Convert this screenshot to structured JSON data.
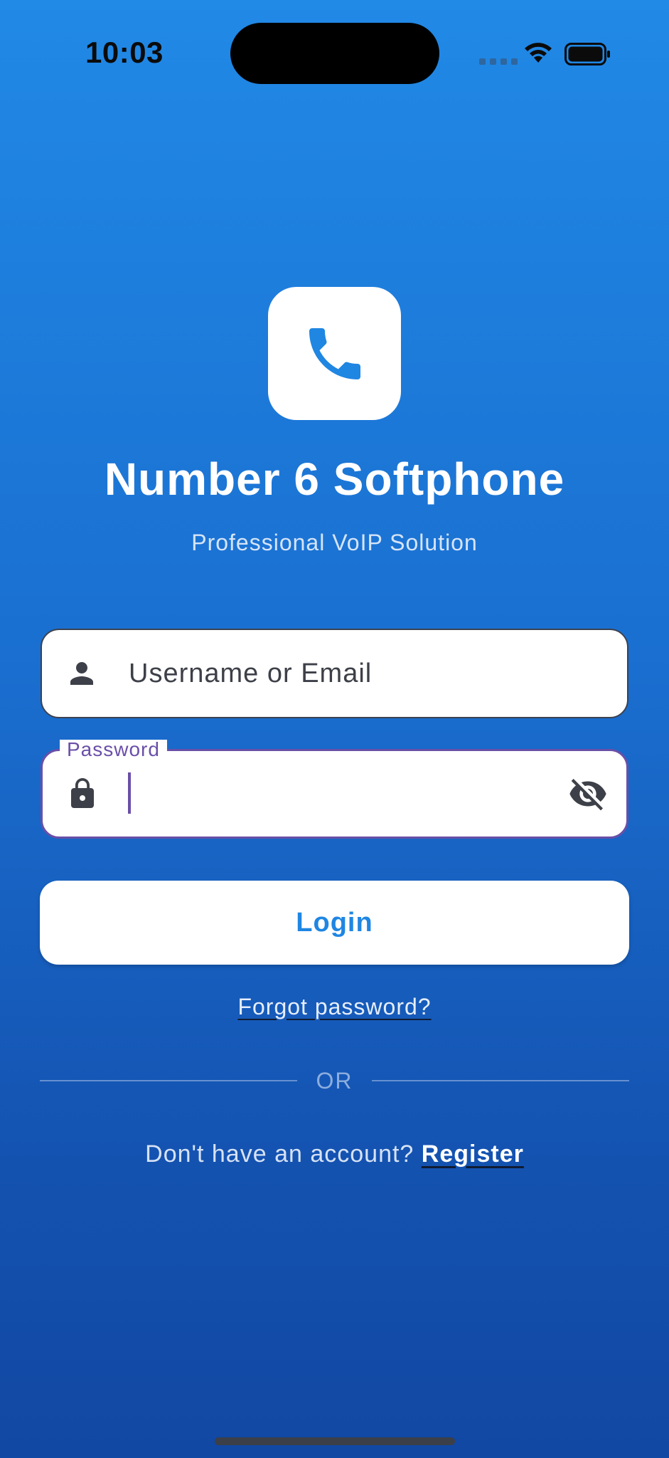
{
  "status_bar": {
    "time": "10:03",
    "icons": [
      "signal-icon",
      "wifi-icon",
      "battery-icon"
    ]
  },
  "app": {
    "logo_icon": "phone-icon",
    "title": "Number 6 Softphone",
    "subtitle": "Professional VoIP Solution"
  },
  "form": {
    "username": {
      "placeholder": "Username or Email",
      "value": "",
      "icon": "person-icon"
    },
    "password": {
      "label": "Password",
      "value": "",
      "icon": "lock-icon",
      "toggle_icon": "visibility-off-icon"
    },
    "login_label": "Login",
    "forgot_label": "Forgot password?"
  },
  "divider": {
    "label": "OR"
  },
  "register": {
    "prompt": "Don't have an account?",
    "link_label": "Register"
  },
  "colors": {
    "background_top": "#2189e6",
    "background_bottom": "#1148a3",
    "accent_blue": "#1f86e2",
    "focus_purple": "#6a4fa8"
  }
}
